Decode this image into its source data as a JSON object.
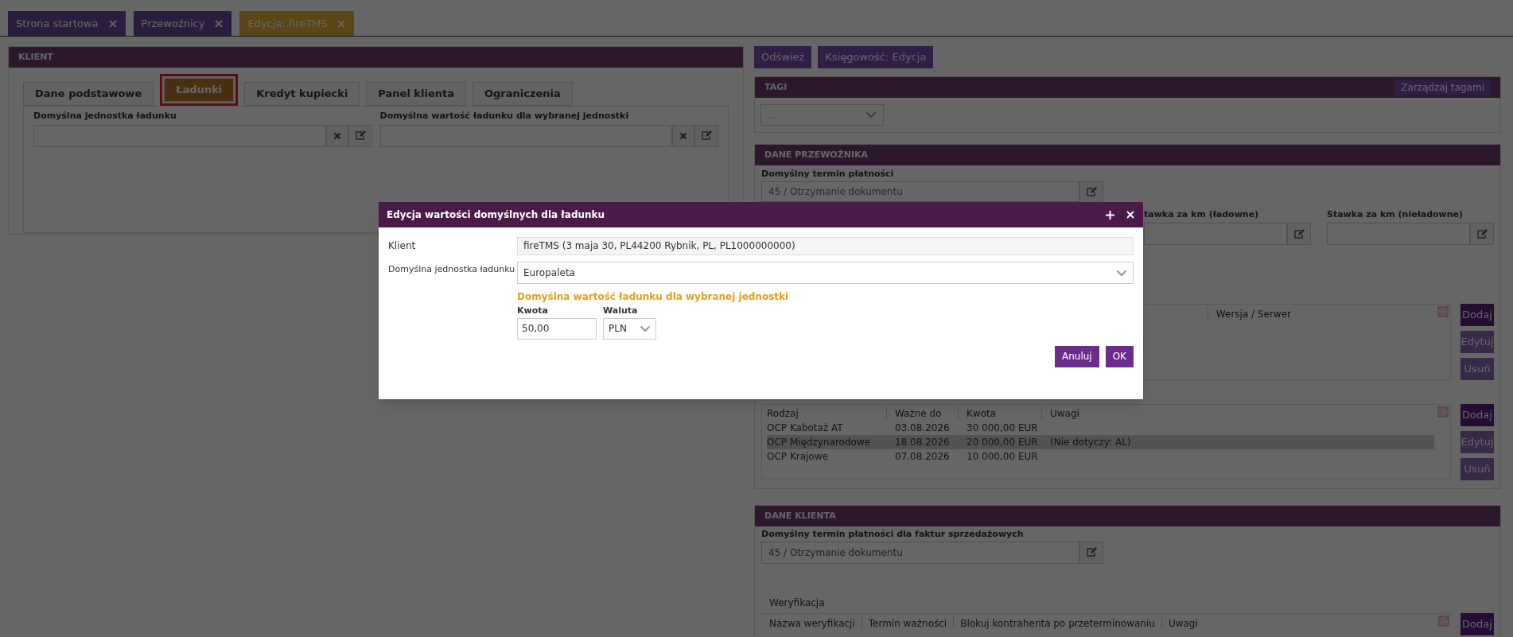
{
  "top_tabs": [
    {
      "label": "Strona startowa",
      "selected": false
    },
    {
      "label": "Przewoźnicy",
      "selected": false
    },
    {
      "label": "Edycja: fireTMS",
      "selected": true
    }
  ],
  "client_panel": {
    "title": "KLIENT",
    "tabs": [
      {
        "label": "Dane podstawowe",
        "selected": false,
        "highlighted": false
      },
      {
        "label": "Ładunki",
        "selected": true,
        "highlighted": true
      },
      {
        "label": "Kredyt kupiecki",
        "selected": false,
        "highlighted": false
      },
      {
        "label": "Panel klienta",
        "selected": false,
        "highlighted": false
      },
      {
        "label": "Ograniczenia",
        "selected": false,
        "highlighted": false
      }
    ],
    "fields": [
      {
        "label": "Domyślna jednostka ładunku"
      },
      {
        "label": "Domyślna wartość ładunku dla wybranej jednostki"
      }
    ]
  },
  "toolbar": [
    "Odśwież",
    "Księgowość: Edycja"
  ],
  "tags_panel": {
    "title": "TAGI",
    "manage_button": "Zarządzaj tagami",
    "select_value": "..."
  },
  "carrier_panel": {
    "title": "DANE PRZEWOŹNIKA",
    "payment_term": {
      "label": "Domyślny termin płatności",
      "value": "45 / Otrzymanie dokumentu"
    },
    "rate_fields": [
      {
        "label": "tawka za km (ładowne)"
      },
      {
        "label": "Stawka za km (nieładowne)"
      }
    ],
    "versions_table": {
      "columns": [
        "Wersja / Serwer"
      ],
      "buttons": [
        {
          "label": "Dodaj",
          "disabled": false
        },
        {
          "label": "Edytuj",
          "disabled": true
        },
        {
          "label": "Usuń",
          "disabled": true
        }
      ]
    },
    "insurance_table": {
      "columns": [
        "Rodzaj",
        "Ważne do",
        "Kwota",
        "Uwagi"
      ],
      "rows": [
        {
          "cells": [
            "OCP Kabotaż AT",
            "03.08.2026",
            "30 000,00 EUR",
            null
          ],
          "selected": false
        },
        {
          "cells": [
            "OCP Międzynarodowe",
            "18.08.2026",
            "20 000,00 EUR",
            "(Nie dotyczy: AL)"
          ],
          "selected": true
        },
        {
          "cells": [
            "OCP Krajowe",
            "07.08.2026",
            "10 000,00 EUR",
            null
          ],
          "selected": false
        }
      ],
      "buttons": [
        {
          "label": "Dodaj",
          "disabled": false
        },
        {
          "label": "Edytuj",
          "disabled": true
        },
        {
          "label": "Usuń",
          "disabled": true
        }
      ]
    }
  },
  "customer_panel": {
    "title": "DANE KLIENTA",
    "payment_term": {
      "label": "Domyślny termin płatności dla faktur sprzedażowych",
      "value": "45 / Otrzymanie dokumentu"
    },
    "verification": {
      "title": "Weryfikacja",
      "columns": [
        "Nazwa weryfikacji",
        "Termin ważności",
        "Blokuj kontrahenta po przeterminowaniu",
        "Uwagi"
      ],
      "buttons": [
        {
          "label": "Dodaj",
          "disabled": false
        }
      ]
    }
  },
  "dialog": {
    "title": "Edycja wartości domyślnych dla ładunku",
    "client_label": "Klient",
    "client_value": "fireTMS (3 maja 30, PL44200 Rybnik, PL, PL1000000000)",
    "unit_label": "Domyślna jednostka ładunku",
    "unit_value": "Europaleta",
    "section_title": "Domyślna wartość ładunku dla wybranej jednostki",
    "amount_label": "Kwota",
    "amount_value": "50,00",
    "currency_label": "Waluta",
    "currency_value": "PLN",
    "buttons": [
      "Anuluj",
      "OK"
    ]
  }
}
